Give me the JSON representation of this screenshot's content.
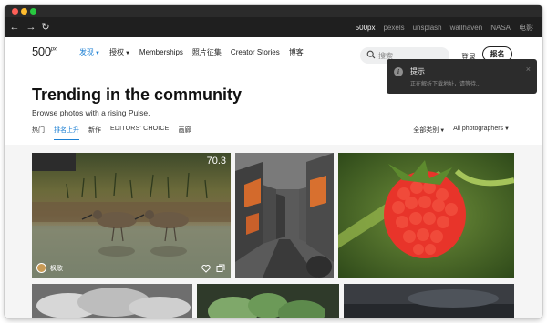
{
  "browser": {
    "links": [
      "500px",
      "pexels",
      "unsplash",
      "wallhaven",
      "NASA",
      "电影"
    ]
  },
  "header": {
    "logo": "500",
    "logo_sup": "px",
    "nav": [
      {
        "label": "发现",
        "dropdown": true,
        "active": true
      },
      {
        "label": "授权",
        "dropdown": true,
        "active": false
      },
      {
        "label": "Memberships",
        "dropdown": false,
        "active": false
      },
      {
        "label": "照片征集",
        "dropdown": false,
        "active": false
      },
      {
        "label": "Creator Stories",
        "dropdown": false,
        "active": false
      },
      {
        "label": "博客",
        "dropdown": false,
        "active": false
      }
    ],
    "search_placeholder": "搜索",
    "login": "登录",
    "signup": "报名"
  },
  "toast": {
    "title": "提示",
    "message": "正在解析下载地址，请等待...",
    "info_glyph": "i",
    "close_glyph": "×"
  },
  "page": {
    "title": "Trending in the community",
    "subtitle": "Browse photos with a rising Pulse."
  },
  "tabs": [
    "热门",
    "排名上升",
    "新作",
    "EDITORS' CHOICE",
    "画廊"
  ],
  "active_tab": "排名上升",
  "filters": [
    "全部类别",
    "All photographers"
  ],
  "photos": [
    {
      "score": "70.3",
      "author": "枫歌",
      "subject": "sandpipers-wading"
    },
    {
      "subject": "street-orange-houses"
    },
    {
      "subject": "raspberry"
    },
    {
      "subject": "clouds"
    },
    {
      "subject": "leaves"
    },
    {
      "subject": "dark-landscape"
    }
  ],
  "colors": {
    "accent": "#1b7fd3",
    "titlebar": "#2b2b2b",
    "toolbar": "#1f1f1f",
    "toast": "#2c2c2c"
  }
}
